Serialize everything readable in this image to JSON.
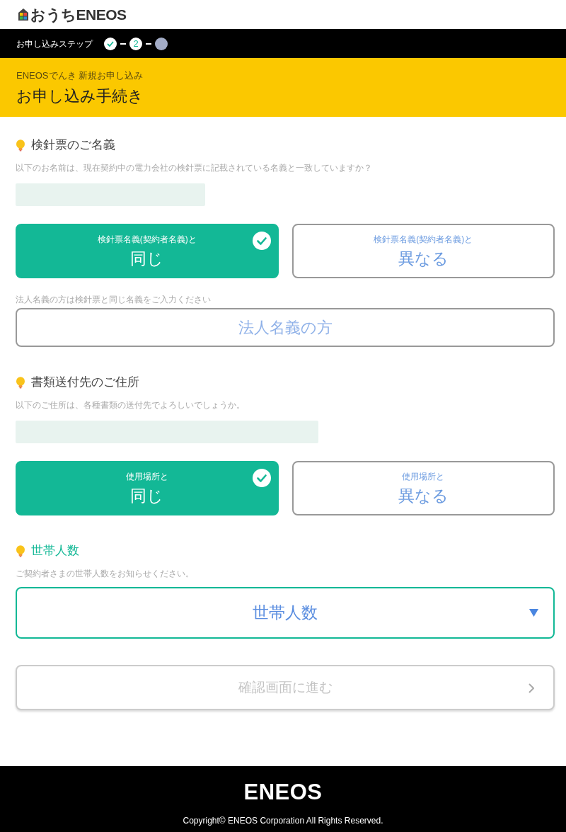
{
  "header": {
    "logo": "おうちENEOS"
  },
  "steps_bar": {
    "label": "お申し込みステップ",
    "steps": [
      {
        "kind": "done"
      },
      {
        "kind": "current",
        "label": "2"
      },
      {
        "kind": "upcoming"
      }
    ]
  },
  "page_header": {
    "subtitle": "ENEOSでんき 新規お申し込み",
    "title": "お申し込み手続き"
  },
  "sections": [
    {
      "kind": "choice",
      "title": "検針票のご名義",
      "highlighted": false,
      "description": "以下のお名前は、現在契約中の電力会社の検針票に記載されている名義と一致していますか？",
      "value_hidden": true,
      "options": [
        {
          "caption": "検針票名義(契約者名義)と",
          "label": "同じ",
          "selected": true
        },
        {
          "caption": "検針票名義(契約者名義)と",
          "label": "異なる",
          "selected": false
        }
      ],
      "note": "法人名義の方は検針票と同じ名義をご入力ください",
      "extra_button": "法人名義の方"
    },
    {
      "kind": "choice",
      "title": "書類送付先のご住所",
      "highlighted": false,
      "description": "以下のご住所は、各種書類の送付先でよろしいでしょうか。",
      "value_hidden": true,
      "options": [
        {
          "caption": "使用場所と",
          "label": "同じ",
          "selected": true
        },
        {
          "caption": "使用場所と",
          "label": "異なる",
          "selected": false
        }
      ]
    },
    {
      "kind": "select",
      "title": "世帯人数",
      "highlighted": true,
      "description": "ご契約者さまの世帯人数をお知らせください。",
      "select": {
        "placeholder": "世帯人数",
        "focused": true
      }
    }
  ],
  "submit": {
    "label": "確認画面に進む",
    "disabled": true
  },
  "footer": {
    "logo": "ENEOS",
    "copyright": "Copyright© ENEOS Corporation All Rights Reserved."
  }
}
